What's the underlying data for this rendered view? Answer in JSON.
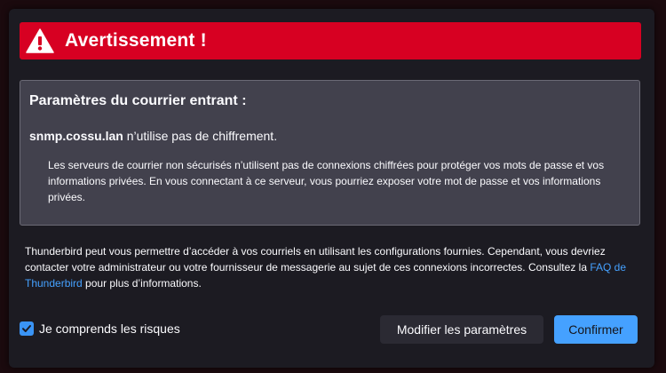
{
  "banner": {
    "title": "Avertissement !",
    "icon": "warning-triangle-icon",
    "color": "#d70022"
  },
  "warning_box": {
    "heading": "Paramètres du courrier entrant :",
    "server": "snmp.cossu.lan",
    "server_message": " n’utilise pas de chiffrement.",
    "detail": "Les serveurs de courrier non sécurisés n’utilisent pas de connexions chiffrées pour protéger vos mots de passe et vos informations privées. En vous connectant à ce serveur, vous pourriez exposer votre mot de passe et vos informations privées."
  },
  "info": {
    "text_before_link": "Thunderbird peut vous permettre d’accéder à vos courriels en utilisant les configurations fournies. Cependant, vous devriez contacter votre administrateur ou votre fournisseur de messagerie au sujet de ces connexions incorrectes. Consultez la ",
    "link_label": "FAQ de Thunderbird",
    "text_after_link": " pour plus d’informations.",
    "link_color": "#45a1ff"
  },
  "acknowledge": {
    "label": "Je comprends les risques",
    "checked": true,
    "icon": "checkmark-icon"
  },
  "buttons": {
    "modify_label": "Modifier les paramètres",
    "confirm_label": "Confirmer",
    "confirm_color": "#45a1ff"
  }
}
